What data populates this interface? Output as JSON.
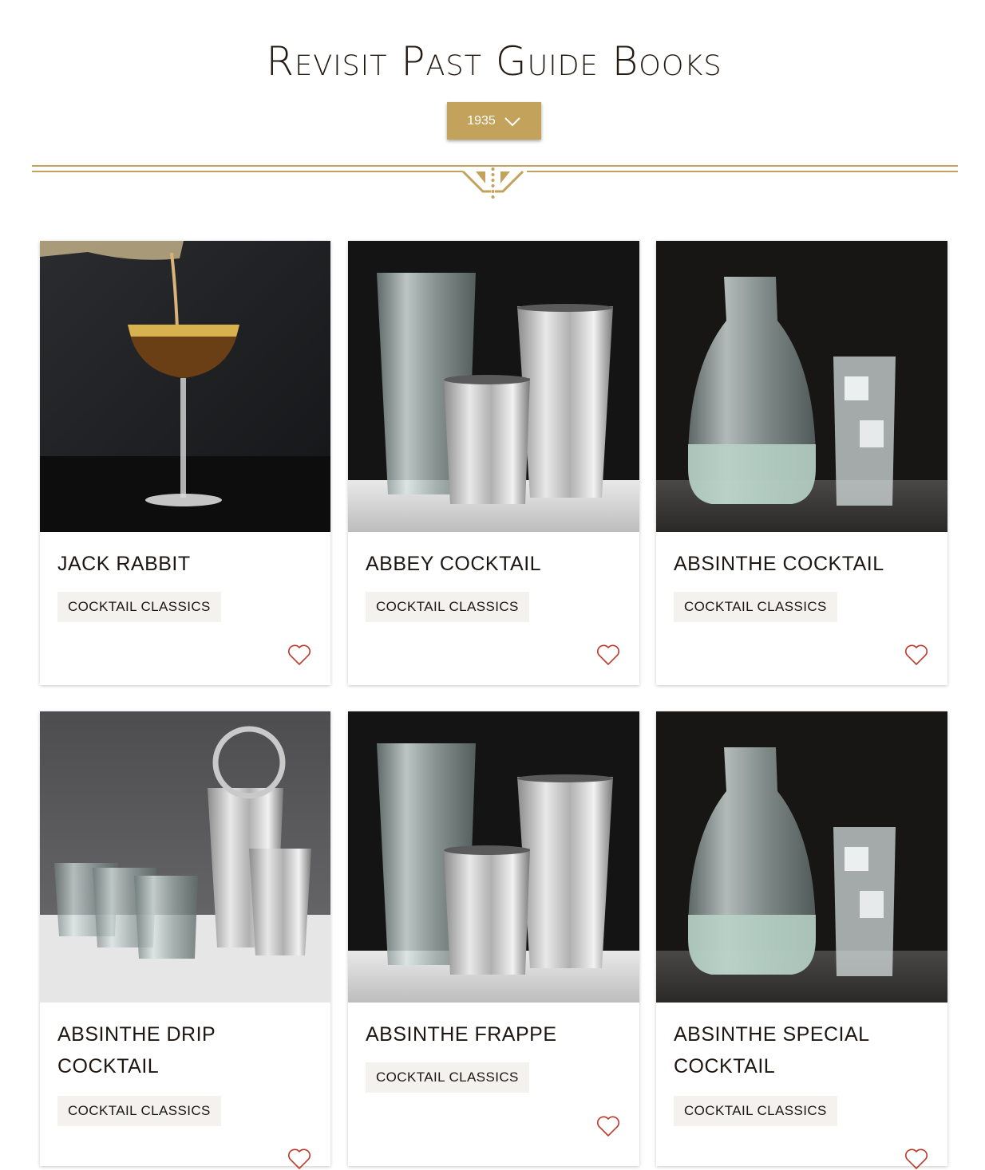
{
  "header": {
    "title": "Revisit Past Guide Books",
    "year_select": {
      "value": "1935",
      "icon": "chevron-down-icon"
    }
  },
  "colors": {
    "accent_gold": "#c3a25b",
    "favorite_red": "#c0392b",
    "tag_background": "#f4f2ef",
    "text_dark": "#1d1611"
  },
  "recipes": [
    {
      "title": "Jack Rabbit",
      "tag": "Cocktail Classics",
      "image": "coupe-glass-pour-photo",
      "favorite_icon": "heart-outline-icon"
    },
    {
      "title": "Abbey Cocktail",
      "tag": "Cocktail Classics",
      "image": "shaker-tins-photo",
      "favorite_icon": "heart-outline-icon"
    },
    {
      "title": "Absinthe Cocktail",
      "tag": "Cocktail Classics",
      "image": "carafe-and-highball-photo",
      "favorite_icon": "heart-outline-icon"
    },
    {
      "title": "Absinthe Drip Cocktail",
      "tag": "Cocktail Classics",
      "image": "rocks-glasses-and-shaker-photo",
      "favorite_icon": "heart-outline-icon"
    },
    {
      "title": "Absinthe Frappe",
      "tag": "Cocktail Classics",
      "image": "shaker-tins-photo",
      "favorite_icon": "heart-outline-icon"
    },
    {
      "title": "Absinthe Special Cocktail",
      "tag": "Cocktail Classics",
      "image": "carafe-and-highball-photo",
      "favorite_icon": "heart-outline-icon"
    }
  ]
}
